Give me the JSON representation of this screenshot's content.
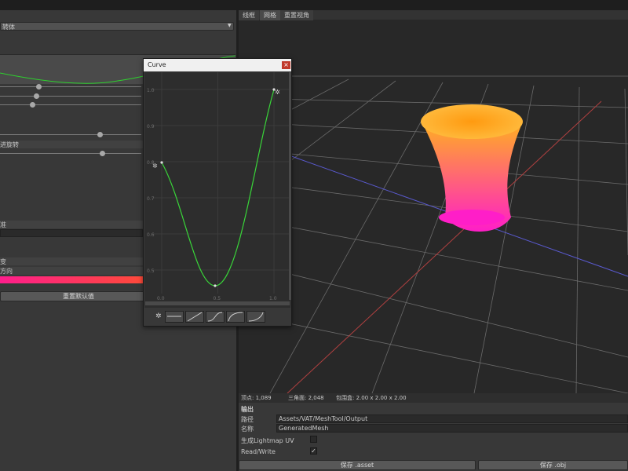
{
  "inspector": {
    "dropdown_value": "转体",
    "sections": {
      "rotation_label": "进旋转",
      "section_a_label": "准",
      "section_b_label": "变",
      "direction_label": "方向"
    },
    "reset_button": "重置默认值"
  },
  "viewport": {
    "tabs": [
      {
        "label": "线框",
        "active": false
      },
      {
        "label": "网格",
        "active": true
      },
      {
        "label": "重置视角",
        "active": false
      }
    ]
  },
  "stats": {
    "vertices": "顶点: 1,089",
    "triangles": "三角面: 2,048",
    "bounds": "包围盒: 2.00 x 2.00 x 2.00"
  },
  "output": {
    "header": "输出",
    "path_label": "路径",
    "path_value": "Assets/VAT/MeshTool/Output",
    "name_label": "名称",
    "name_value": "GeneratedMesh",
    "lightmap_label": "生成Lightmap UV",
    "lightmap_checked": false,
    "readwrite_label": "Read/Write",
    "readwrite_checked": true,
    "save_asset": "保存 .asset",
    "save_obj": "保存 .obj"
  },
  "curve_window": {
    "title": "Curve",
    "close_glyph": "×",
    "y_ticks": [
      "1.0",
      "0.9",
      "0.8",
      "0.7",
      "0.6",
      "0.5"
    ],
    "x_ticks": [
      "0.0",
      "0.5",
      "1.0"
    ],
    "curve_color": "#39d639",
    "settings_icon": "gear-icon",
    "presets": [
      "constant",
      "linear",
      "ease-in-out",
      "ease-out",
      "ease-in"
    ]
  },
  "colors": {
    "mesh_top": "#ffb020",
    "mesh_bottom": "#ff1ec8",
    "gradient_start": "#ff1e8c",
    "gradient_end": "#ff4a3a",
    "x_axis": "#b04040",
    "z_axis": "#5a5ad0",
    "grid": "#6a6a6a"
  }
}
